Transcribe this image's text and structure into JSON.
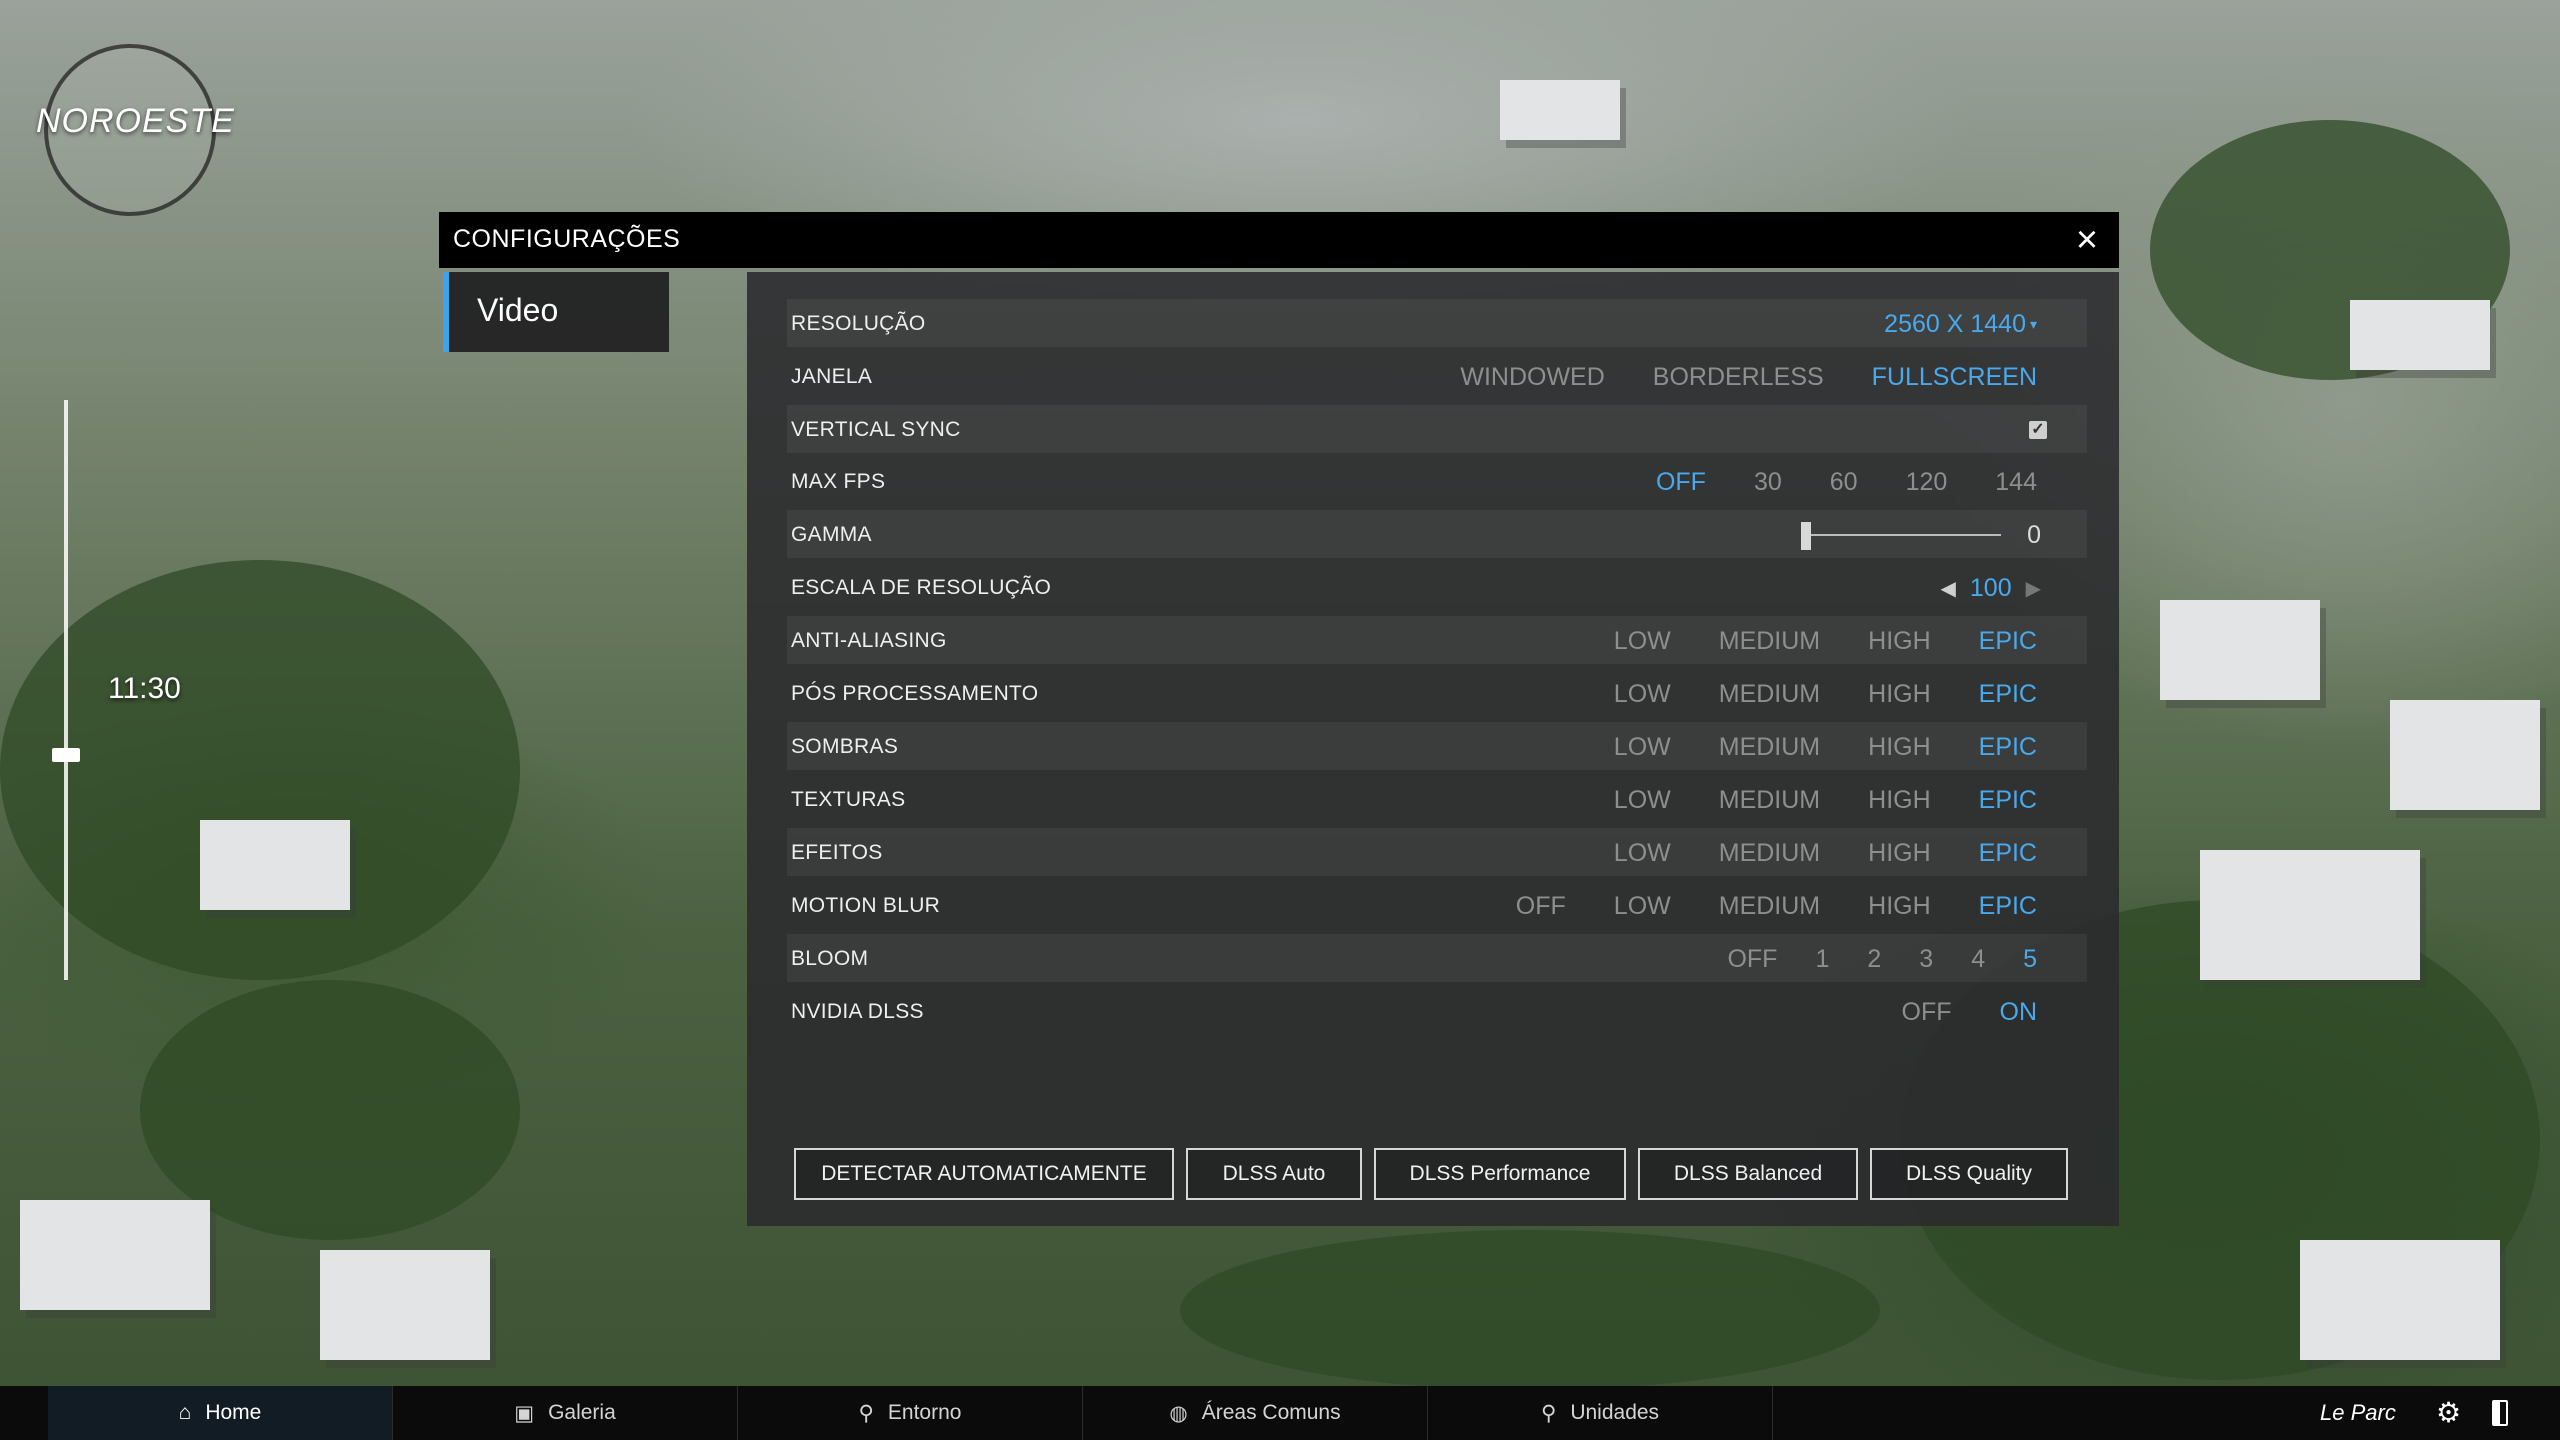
{
  "map": {
    "region_label": "NOROESTE",
    "time": "11:30"
  },
  "settings": {
    "title": "CONFIGURAÇÕES",
    "close_icon": "×",
    "tab_video": "Video",
    "accent_color": "#4aa8ec",
    "rows": {
      "resolucao": {
        "label": "RESOLUÇÃO",
        "value": "2560 X 1440",
        "caret": "▾"
      },
      "janela": {
        "label": "JANELA",
        "options": [
          "WINDOWED",
          "BORDERLESS",
          "FULLSCREEN"
        ],
        "selected": "FULLSCREEN"
      },
      "vsync": {
        "label": "VERTICAL SYNC",
        "checked": true,
        "check_glyph": "✓"
      },
      "maxfps": {
        "label": "MAX FPS",
        "options": [
          "OFF",
          "30",
          "60",
          "120",
          "144"
        ],
        "selected": "OFF"
      },
      "gamma": {
        "label": "GAMMA",
        "value": "0",
        "level": 0
      },
      "escala": {
        "label": "ESCALA DE RESOLUÇÃO",
        "value": "100",
        "left": "◀",
        "right": "▶"
      },
      "antialiasing": {
        "label": "ANTI-ALIASING",
        "options": [
          "LOW",
          "MEDIUM",
          "HIGH",
          "EPIC"
        ],
        "selected": "EPIC"
      },
      "posproc": {
        "label": "PÓS PROCESSAMENTO",
        "options": [
          "LOW",
          "MEDIUM",
          "HIGH",
          "EPIC"
        ],
        "selected": "EPIC"
      },
      "sombras": {
        "label": "SOMBRAS",
        "options": [
          "LOW",
          "MEDIUM",
          "HIGH",
          "EPIC"
        ],
        "selected": "EPIC"
      },
      "texturas": {
        "label": "TEXTURAS",
        "options": [
          "LOW",
          "MEDIUM",
          "HIGH",
          "EPIC"
        ],
        "selected": "EPIC"
      },
      "efeitos": {
        "label": "EFEITOS",
        "options": [
          "LOW",
          "MEDIUM",
          "HIGH",
          "EPIC"
        ],
        "selected": "EPIC"
      },
      "motionblur": {
        "label": "MOTION BLUR",
        "options": [
          "OFF",
          "LOW",
          "MEDIUM",
          "HIGH",
          "EPIC"
        ],
        "selected": "EPIC"
      },
      "bloom": {
        "label": "BLOOM",
        "options": [
          "OFF",
          "1",
          "2",
          "3",
          "4",
          "5"
        ],
        "selected": "5"
      },
      "dlss": {
        "label": "NVIDIA DLSS",
        "options": [
          "OFF",
          "ON"
        ],
        "selected": "ON"
      }
    },
    "buttons": {
      "auto_detect": "DETECTAR AUTOMATICAMENTE",
      "dlss_auto": "DLSS Auto",
      "dlss_performance": "DLSS Performance",
      "dlss_balanced": "DLSS Balanced",
      "dlss_quality": "DLSS Quality"
    }
  },
  "nav": {
    "home": "Home",
    "galeria": "Galeria",
    "entorno": "Entorno",
    "areas_comuns": "Áreas Comuns",
    "unidades": "Unidades",
    "brand": "Le Parc",
    "icons": {
      "home": "⌂",
      "galeria": "▣",
      "entorno": "⚲",
      "areas": "◍",
      "unidades": "⚲",
      "gear": "⚙"
    }
  }
}
